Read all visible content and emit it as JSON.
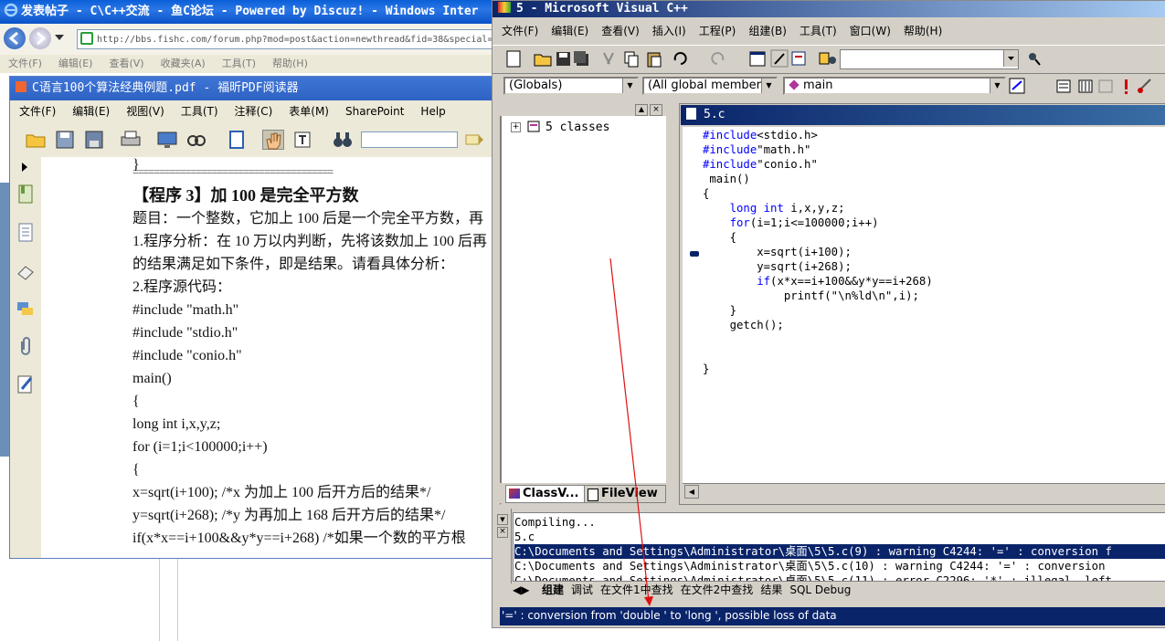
{
  "ie": {
    "title": "发表帖子 - C\\C++交流 - 鱼C论坛 - Powered by Discuz! - Windows Inter",
    "address": "http://bbs.fishc.com/forum.php?mod=post&action=newthread&fid=38&special=",
    "menu": [
      "文件(F)",
      "编辑(E)",
      "查看(V)",
      "收藏夹(A)",
      "工具(T)",
      "帮助(H)"
    ]
  },
  "pdf": {
    "title": "C语言100个算法经典例题.pdf - 福昕PDF阅读器",
    "menu": [
      "文件(F)",
      "编辑(E)",
      "视图(V)",
      "工具(T)",
      "注释(C)",
      "表单(M)",
      "SharePoint",
      "Help"
    ],
    "lines": [
      "}",
      "======================================",
      "【程序 3】加 100 是完全平方数",
      "题目：一个整数，它加上 100 后是一个完全平方数，再",
      "1.程序分析：在 10 万以内判断，先将该数加上 100 后再",
      "的结果满足如下条件，即是结果。请看具体分析：",
      "2.程序源代码：",
      "#include \"math.h\"",
      "#include \"stdio.h\"",
      "#include \"conio.h\"",
      "main()",
      "{",
      " long int i,x,y,z;",
      " for (i=1;i<100000;i++)",
      " {",
      "  x=sqrt(i+100); /*x 为加上 100 后开方后的结果*/",
      "  y=sqrt(i+268); /*y 为再加上 168 后开方后的结果*/",
      "  if(x*x==i+100&&y*y==i+268) /*如果一个数的平方根"
    ]
  },
  "vc": {
    "title": "5 - Microsoft Visual C++",
    "menu": [
      "文件(F)",
      "编辑(E)",
      "查看(V)",
      "插入(I)",
      "工程(P)",
      "组建(B)",
      "工具(T)",
      "窗口(W)",
      "帮助(H)"
    ],
    "combo_globals": "(Globals)",
    "combo_members": "(All global members",
    "combo_func": "main",
    "tree_root": "5 classes",
    "ws_tab_class": "ClassV...",
    "ws_tab_file": "FileView",
    "editor_title": "5.c",
    "code": [
      "#include<stdio.h>",
      "#include\"math.h\"",
      "#include\"conio.h\"",
      " main()",
      "{",
      "    long int i,x,y,z;",
      "    for(i=1;i<=100000;i++)",
      "    {",
      "        x=sqrt(i+100);",
      "        y=sqrt(i+268);",
      "        if(x*x==i+100&&y*y==i+268)",
      "            printf(\"\\n%ld\\n\",i);",
      "    }",
      "    getch();",
      "",
      "",
      "}"
    ],
    "output": [
      "Compiling...",
      "5.c",
      "C:\\Documents and Settings\\Administrator\\桌面\\5\\5.c(9) : warning C4244: '=' : conversion f",
      "C:\\Documents and Settings\\Administrator\\桌面\\5\\5.c(10) : warning C4244: '=' : conversion",
      "C:\\Documents and Settings\\Administrator\\桌面\\5\\5.c(11) : error C2296: '*' : illegal, left"
    ],
    "output_tabs": [
      "组建",
      "调试",
      "在文件1中查找",
      "在文件2中查找",
      "结果",
      "SQL Debug"
    ],
    "status": "'=' : conversion from 'double ' to 'long ', possible loss of data"
  }
}
